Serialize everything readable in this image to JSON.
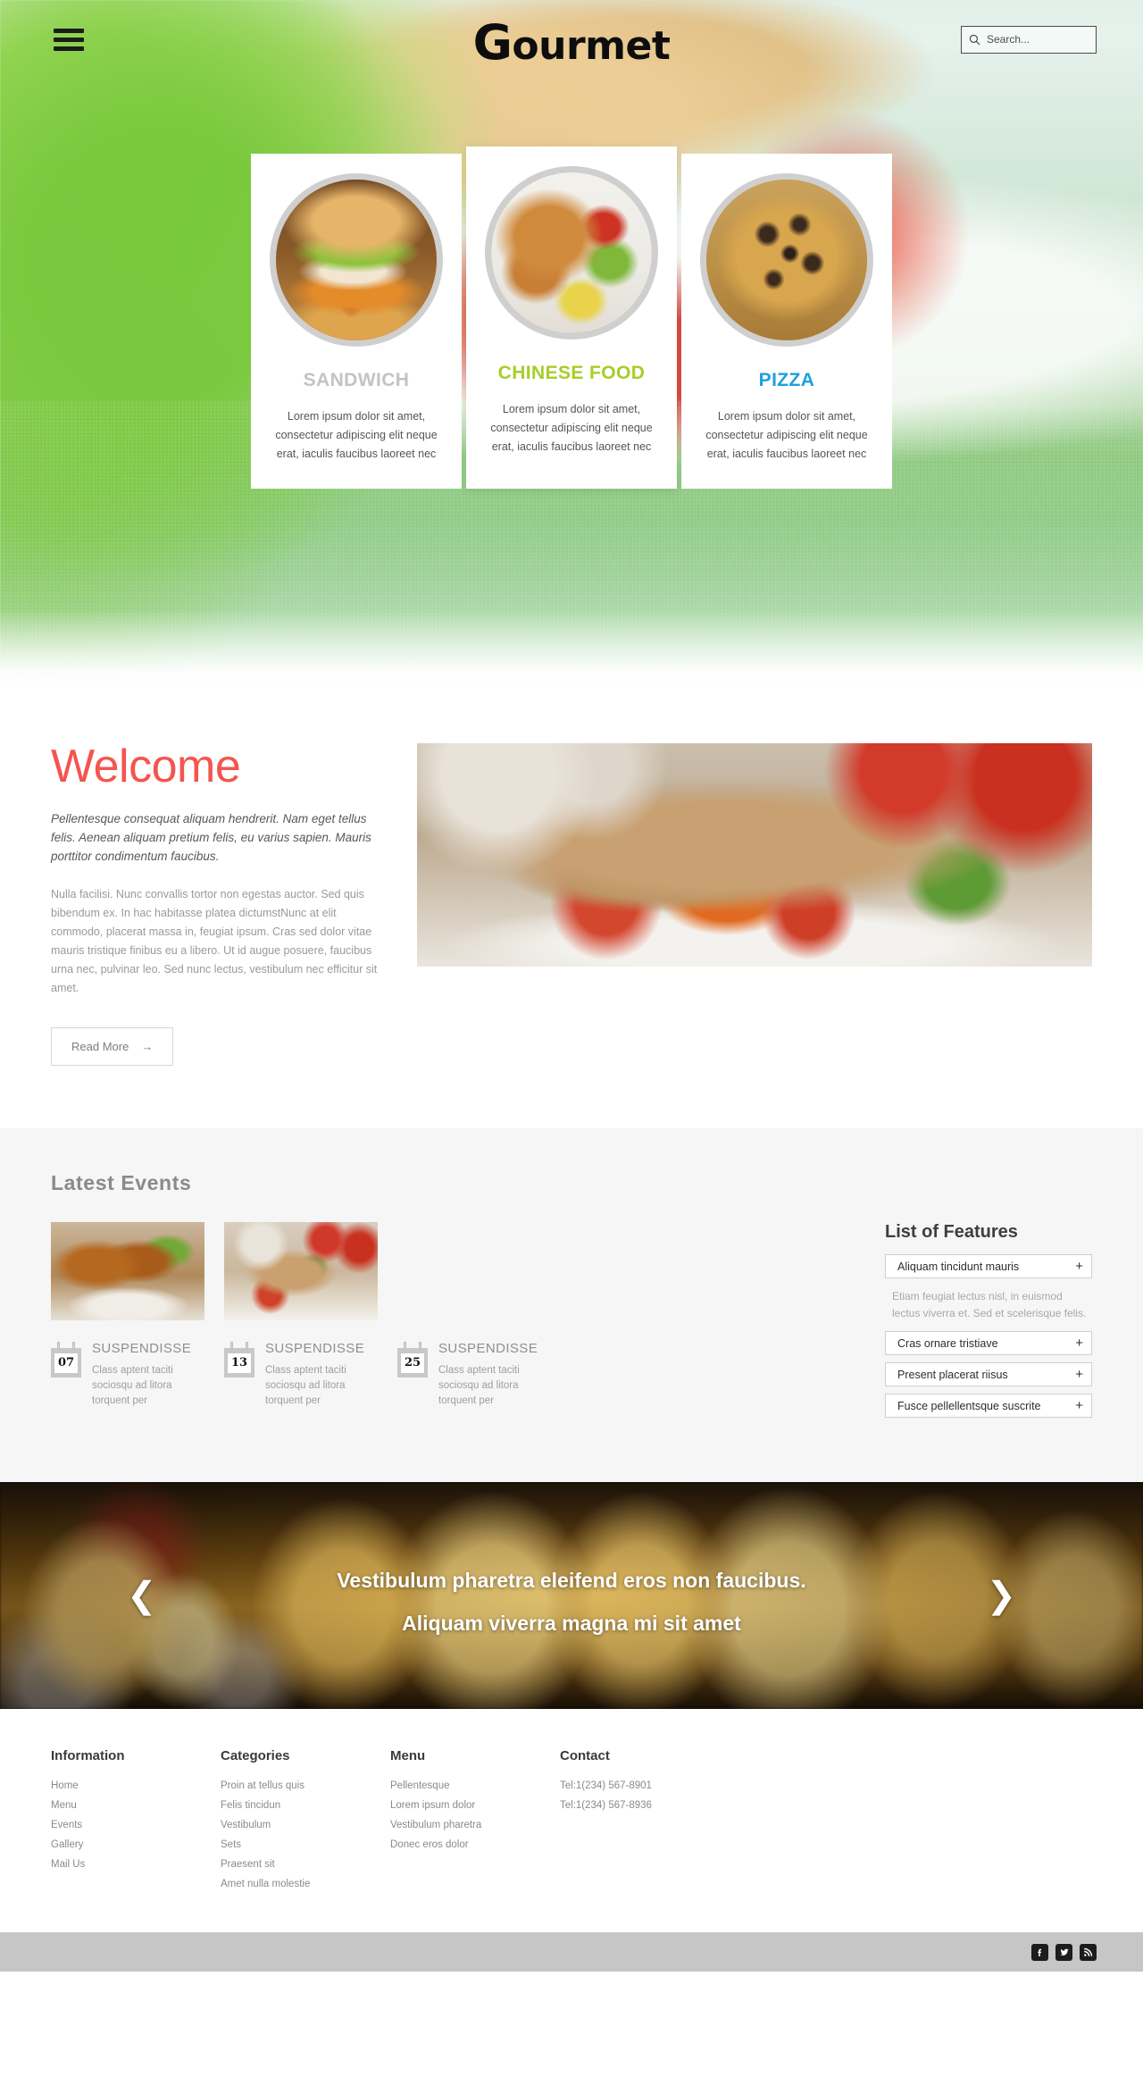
{
  "header": {
    "brand_cap": "G",
    "brand_rest": "ourmet",
    "search_placeholder": "Search...",
    "menu_icon": "hamburger-menu-icon",
    "search_icon": "search-icon"
  },
  "hero_cards": [
    {
      "title": "SANDWICH",
      "color": "#c3c3c3",
      "text": "Lorem ipsum dolor sit amet, consectetur adipiscing elit neque erat, iaculis faucibus laoreet nec",
      "image": "sandwich-photo"
    },
    {
      "title": "CHINESE FOOD",
      "color": "#a6ce27",
      "text": "Lorem ipsum dolor sit amet, consectetur adipiscing elit neque erat, iaculis faucibus laoreet nec",
      "image": "chinese-food-photo"
    },
    {
      "title": "PIZZA",
      "color": "#1e9fe0",
      "text": "Lorem ipsum dolor sit amet, consectetur adipiscing elit neque erat, iaculis faucibus laoreet nec",
      "image": "pizza-photo"
    }
  ],
  "welcome": {
    "title": "Welcome",
    "title_color": "#f4554e",
    "lead": "Pellentesque consequat aliquam hendrerit. Nam eget tellus felis. Aenean aliquam pretium felis, eu varius sapien. Mauris porttitor condimentum faucibus.",
    "body": "Nulla facilisi. Nunc convallis tortor non egestas auctor. Sed quis bibendum ex. In hac habitasse platea dictumstNunc at elit commodo, placerat massa in, feugiat ipsum. Cras sed dolor vitae mauris tristique finibus eu a libero. Ut id augue posuere, faucibus urna nec, pulvinar leo. Sed nunc lectus, vestibulum nec efficitur sit amet.",
    "button_label": "Read More",
    "button_arrow": "→",
    "image": "goulash-dish-photo"
  },
  "events": {
    "section_title": "Latest Events",
    "items": [
      {
        "day": "07",
        "title": "SUSPENDISSE",
        "desc": "Class aptent taciti sociosqu ad litora torquent per",
        "image": "grilled-meat-photo"
      },
      {
        "day": "13",
        "title": "SUSPENDISSE",
        "desc": "Class aptent taciti sociosqu ad litora torquent per",
        "image": "meat-vegetables-photo"
      },
      {
        "day": "25",
        "title": "SUSPENDISSE",
        "desc": "Class aptent taciti sociosqu ad litora torquent per",
        "image": "burger-fries-photo"
      }
    ]
  },
  "features": {
    "title": "List of Features",
    "items": [
      {
        "label": "Aliquam tincidunt mauris",
        "toggle": "+",
        "body": "Etiam feugiat lectus nisl, in euismod lectus viverra et. Sed et scelerisque felis.",
        "expanded": true
      },
      {
        "label": "Cras ornare tristiave",
        "toggle": "+",
        "body": "",
        "expanded": false
      },
      {
        "label": "Present placerat riisus",
        "toggle": "+",
        "body": "",
        "expanded": false
      },
      {
        "label": "Fusce pellellentsque suscrite",
        "toggle": "+",
        "body": "",
        "expanded": false
      }
    ]
  },
  "carousel": {
    "line1": "Vestibulum pharetra eleifend eros non faucibus.",
    "line2": "Aliquam viverra magna mi sit amet",
    "prev": "❮",
    "next": "❯",
    "image": "champagne-glasses-photo"
  },
  "footer": {
    "columns": [
      {
        "heading": "Information",
        "links": [
          "Home",
          "Menu",
          "Events",
          "Gallery",
          "Mail Us"
        ]
      },
      {
        "heading": "Categories",
        "links": [
          "Proin at tellus quis",
          "Felis tincidun",
          "Vestibulum",
          "Sets",
          "Praesent sit",
          "Amet nulla molestie"
        ]
      },
      {
        "heading": "Menu",
        "links": [
          "Pellentesque",
          "Lorem ipsum dolor",
          "Vestibulum pharetra",
          "Donec eros dolor"
        ]
      },
      {
        "heading": "Contact",
        "links": [
          "Tel:1(234) 567-8901",
          "Tel:1(234) 567-8936"
        ]
      }
    ],
    "social": [
      "facebook-icon",
      "twitter-icon",
      "rss-icon"
    ]
  }
}
